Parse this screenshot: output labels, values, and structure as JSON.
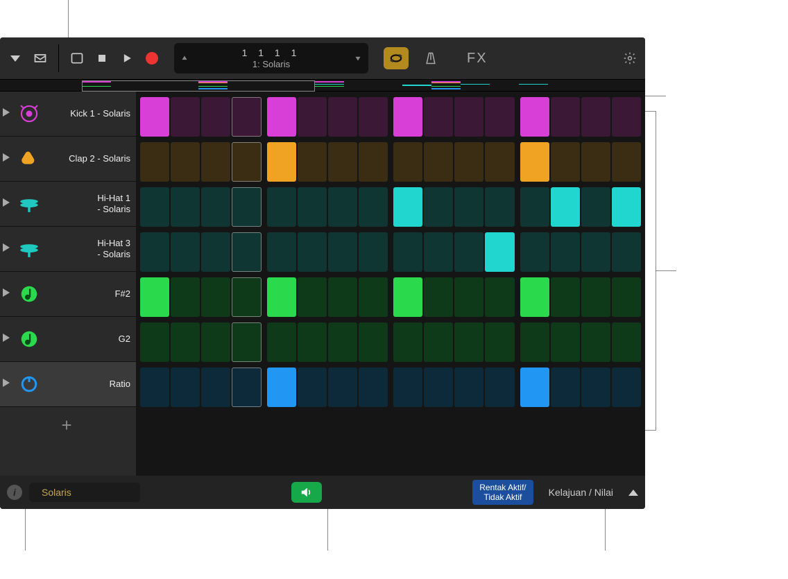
{
  "toolbar": {
    "position": "1  1  1      1",
    "preset_name": "1: Solaris",
    "fx_label": "FX"
  },
  "tracks": [
    {
      "name": "Kick 1 - Solaris",
      "icon": "kick",
      "color": "#d83fd6",
      "selected": false,
      "pattern": [
        1,
        0,
        0,
        0,
        1,
        0,
        0,
        0,
        1,
        0,
        0,
        0,
        1,
        0,
        0,
        0
      ],
      "on": "#d83fd6",
      "off": "#3b1836"
    },
    {
      "name": "Clap 2 - Solaris",
      "icon": "clap",
      "color": "#f0a223",
      "selected": false,
      "pattern": [
        0,
        0,
        0,
        0,
        1,
        0,
        0,
        0,
        0,
        0,
        0,
        0,
        1,
        0,
        0,
        0
      ],
      "on": "#f0a223",
      "off": "#3a2d13"
    },
    {
      "name": "Hi-Hat 1 - Solaris",
      "icon": "hihat",
      "color": "#20c9c0",
      "selected": false,
      "pattern": [
        0,
        0,
        0,
        0,
        0,
        0,
        0,
        0,
        1,
        0,
        0,
        0,
        0,
        1,
        0,
        1
      ],
      "on": "#20d6cf",
      "off": "#0f3633"
    },
    {
      "name": "Hi-Hat 3 - Solaris",
      "icon": "hihat",
      "color": "#20c9c0",
      "selected": false,
      "pattern": [
        0,
        0,
        0,
        0,
        0,
        0,
        0,
        0,
        0,
        0,
        0,
        1,
        0,
        0,
        0,
        0
      ],
      "on": "#20d6cf",
      "off": "#0f3633"
    },
    {
      "name": "F#2",
      "icon": "note",
      "color": "#2bd94c",
      "selected": false,
      "pattern": [
        1,
        0,
        0,
        0,
        1,
        0,
        0,
        0,
        1,
        0,
        0,
        0,
        1,
        0,
        0,
        0
      ],
      "on": "#2bd94c",
      "off": "#0f3a19"
    },
    {
      "name": "G2",
      "icon": "note",
      "color": "#2bd94c",
      "selected": false,
      "pattern": [
        0,
        0,
        0,
        0,
        0,
        0,
        0,
        0,
        0,
        0,
        0,
        0,
        0,
        0,
        0,
        0
      ],
      "on": "#2bd94c",
      "off": "#0f3a19"
    },
    {
      "name": "Ratio",
      "icon": "knob",
      "color": "#2196f3",
      "selected": true,
      "pattern": [
        0,
        0,
        0,
        0,
        1,
        0,
        0,
        0,
        0,
        0,
        0,
        0,
        1,
        0,
        0,
        0
      ],
      "on": "#2196f3",
      "off": "#0d2a3a"
    }
  ],
  "footer": {
    "info_tooltip": "i",
    "preset": "Solaris",
    "beat_toggle": "Rentak Aktif/\nTidak Aktif",
    "speed_label": "Kelajuan / Nilai"
  },
  "overview_colors": [
    "#d83fd6",
    "#f0a223",
    "#20d6cf",
    "#20d6cf",
    "#2bd94c",
    "#2bd94c",
    "#2196f3"
  ]
}
